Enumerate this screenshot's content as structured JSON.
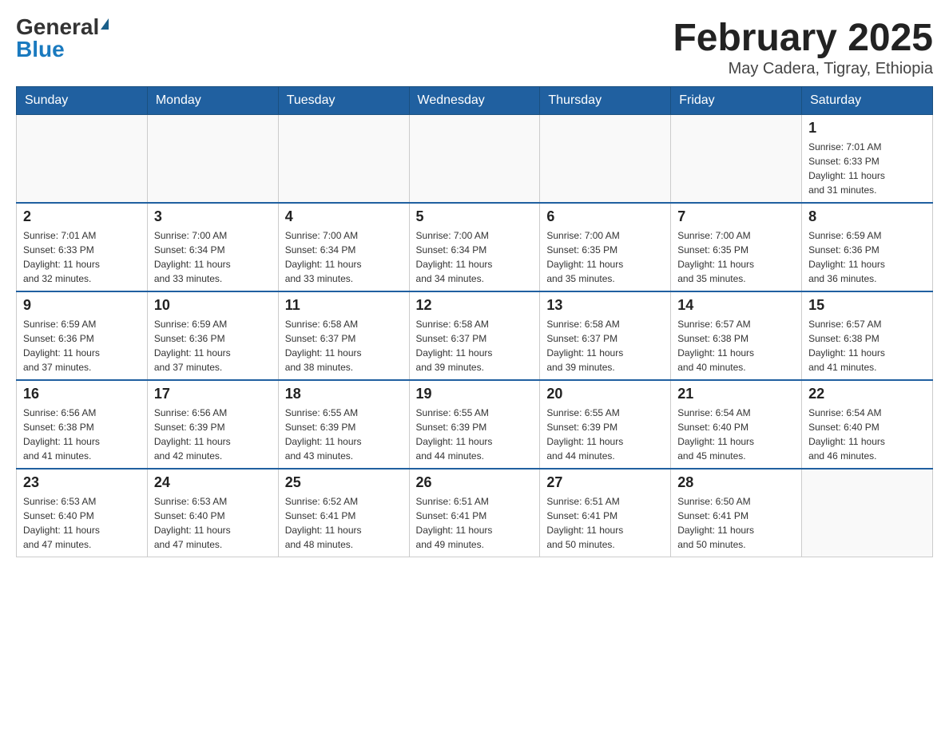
{
  "logo": {
    "general": "General",
    "blue": "Blue"
  },
  "title": "February 2025",
  "subtitle": "May Cadera, Tigray, Ethiopia",
  "days_of_week": [
    "Sunday",
    "Monday",
    "Tuesday",
    "Wednesday",
    "Thursday",
    "Friday",
    "Saturday"
  ],
  "weeks": [
    [
      {
        "day": "",
        "info": ""
      },
      {
        "day": "",
        "info": ""
      },
      {
        "day": "",
        "info": ""
      },
      {
        "day": "",
        "info": ""
      },
      {
        "day": "",
        "info": ""
      },
      {
        "day": "",
        "info": ""
      },
      {
        "day": "1",
        "info": "Sunrise: 7:01 AM\nSunset: 6:33 PM\nDaylight: 11 hours\nand 31 minutes."
      }
    ],
    [
      {
        "day": "2",
        "info": "Sunrise: 7:01 AM\nSunset: 6:33 PM\nDaylight: 11 hours\nand 32 minutes."
      },
      {
        "day": "3",
        "info": "Sunrise: 7:00 AM\nSunset: 6:34 PM\nDaylight: 11 hours\nand 33 minutes."
      },
      {
        "day": "4",
        "info": "Sunrise: 7:00 AM\nSunset: 6:34 PM\nDaylight: 11 hours\nand 33 minutes."
      },
      {
        "day": "5",
        "info": "Sunrise: 7:00 AM\nSunset: 6:34 PM\nDaylight: 11 hours\nand 34 minutes."
      },
      {
        "day": "6",
        "info": "Sunrise: 7:00 AM\nSunset: 6:35 PM\nDaylight: 11 hours\nand 35 minutes."
      },
      {
        "day": "7",
        "info": "Sunrise: 7:00 AM\nSunset: 6:35 PM\nDaylight: 11 hours\nand 35 minutes."
      },
      {
        "day": "8",
        "info": "Sunrise: 6:59 AM\nSunset: 6:36 PM\nDaylight: 11 hours\nand 36 minutes."
      }
    ],
    [
      {
        "day": "9",
        "info": "Sunrise: 6:59 AM\nSunset: 6:36 PM\nDaylight: 11 hours\nand 37 minutes."
      },
      {
        "day": "10",
        "info": "Sunrise: 6:59 AM\nSunset: 6:36 PM\nDaylight: 11 hours\nand 37 minutes."
      },
      {
        "day": "11",
        "info": "Sunrise: 6:58 AM\nSunset: 6:37 PM\nDaylight: 11 hours\nand 38 minutes."
      },
      {
        "day": "12",
        "info": "Sunrise: 6:58 AM\nSunset: 6:37 PM\nDaylight: 11 hours\nand 39 minutes."
      },
      {
        "day": "13",
        "info": "Sunrise: 6:58 AM\nSunset: 6:37 PM\nDaylight: 11 hours\nand 39 minutes."
      },
      {
        "day": "14",
        "info": "Sunrise: 6:57 AM\nSunset: 6:38 PM\nDaylight: 11 hours\nand 40 minutes."
      },
      {
        "day": "15",
        "info": "Sunrise: 6:57 AM\nSunset: 6:38 PM\nDaylight: 11 hours\nand 41 minutes."
      }
    ],
    [
      {
        "day": "16",
        "info": "Sunrise: 6:56 AM\nSunset: 6:38 PM\nDaylight: 11 hours\nand 41 minutes."
      },
      {
        "day": "17",
        "info": "Sunrise: 6:56 AM\nSunset: 6:39 PM\nDaylight: 11 hours\nand 42 minutes."
      },
      {
        "day": "18",
        "info": "Sunrise: 6:55 AM\nSunset: 6:39 PM\nDaylight: 11 hours\nand 43 minutes."
      },
      {
        "day": "19",
        "info": "Sunrise: 6:55 AM\nSunset: 6:39 PM\nDaylight: 11 hours\nand 44 minutes."
      },
      {
        "day": "20",
        "info": "Sunrise: 6:55 AM\nSunset: 6:39 PM\nDaylight: 11 hours\nand 44 minutes."
      },
      {
        "day": "21",
        "info": "Sunrise: 6:54 AM\nSunset: 6:40 PM\nDaylight: 11 hours\nand 45 minutes."
      },
      {
        "day": "22",
        "info": "Sunrise: 6:54 AM\nSunset: 6:40 PM\nDaylight: 11 hours\nand 46 minutes."
      }
    ],
    [
      {
        "day": "23",
        "info": "Sunrise: 6:53 AM\nSunset: 6:40 PM\nDaylight: 11 hours\nand 47 minutes."
      },
      {
        "day": "24",
        "info": "Sunrise: 6:53 AM\nSunset: 6:40 PM\nDaylight: 11 hours\nand 47 minutes."
      },
      {
        "day": "25",
        "info": "Sunrise: 6:52 AM\nSunset: 6:41 PM\nDaylight: 11 hours\nand 48 minutes."
      },
      {
        "day": "26",
        "info": "Sunrise: 6:51 AM\nSunset: 6:41 PM\nDaylight: 11 hours\nand 49 minutes."
      },
      {
        "day": "27",
        "info": "Sunrise: 6:51 AM\nSunset: 6:41 PM\nDaylight: 11 hours\nand 50 minutes."
      },
      {
        "day": "28",
        "info": "Sunrise: 6:50 AM\nSunset: 6:41 PM\nDaylight: 11 hours\nand 50 minutes."
      },
      {
        "day": "",
        "info": ""
      }
    ]
  ]
}
